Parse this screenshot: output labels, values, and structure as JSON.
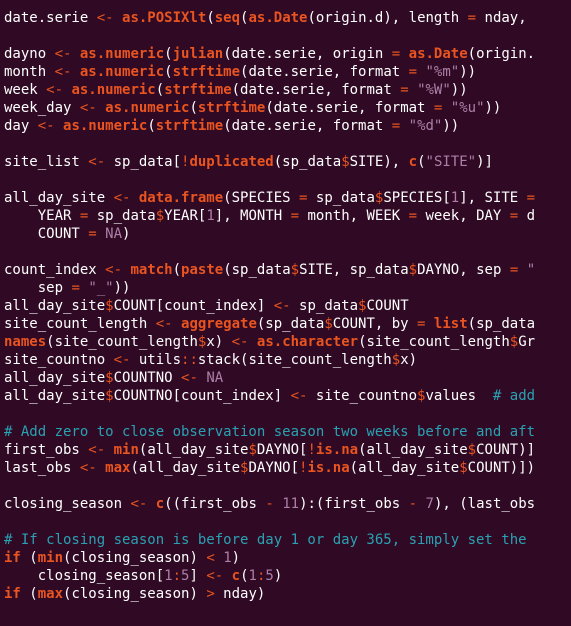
{
  "colors": {
    "background": "#300a24",
    "plain": "#ffffff",
    "operator": "#e95420",
    "function": "#e95420",
    "keyword": "#e95420",
    "string": "#ad7fa8",
    "number": "#ad7fa8",
    "constant": "#ad7fa8",
    "comment": "#2aa1b3"
  },
  "lines": [
    [
      [
        "plain",
        "date.serie "
      ],
      [
        "op",
        "<-"
      ],
      [
        "plain",
        " "
      ],
      [
        "fn",
        "as.POSIXlt"
      ],
      [
        "plain",
        "("
      ],
      [
        "fn",
        "seq"
      ],
      [
        "plain",
        "("
      ],
      [
        "fn",
        "as.Date"
      ],
      [
        "plain",
        "(origin.d), length "
      ],
      [
        "op",
        "="
      ],
      [
        "plain",
        " nday, "
      ]
    ],
    [],
    [
      [
        "plain",
        "dayno "
      ],
      [
        "op",
        "<-"
      ],
      [
        "plain",
        " "
      ],
      [
        "fn",
        "as.numeric"
      ],
      [
        "plain",
        "("
      ],
      [
        "fn",
        "julian"
      ],
      [
        "plain",
        "(date.serie, origin "
      ],
      [
        "op",
        "="
      ],
      [
        "plain",
        " "
      ],
      [
        "fn",
        "as.Date"
      ],
      [
        "plain",
        "(origin."
      ]
    ],
    [
      [
        "plain",
        "month "
      ],
      [
        "op",
        "<-"
      ],
      [
        "plain",
        " "
      ],
      [
        "fn",
        "as.numeric"
      ],
      [
        "plain",
        "("
      ],
      [
        "fn",
        "strftime"
      ],
      [
        "plain",
        "(date.serie, format "
      ],
      [
        "op",
        "="
      ],
      [
        "plain",
        " "
      ],
      [
        "str",
        "\"%m\""
      ],
      [
        "plain",
        "))"
      ]
    ],
    [
      [
        "plain",
        "week "
      ],
      [
        "op",
        "<-"
      ],
      [
        "plain",
        " "
      ],
      [
        "fn",
        "as.numeric"
      ],
      [
        "plain",
        "("
      ],
      [
        "fn",
        "strftime"
      ],
      [
        "plain",
        "(date.serie, format "
      ],
      [
        "op",
        "="
      ],
      [
        "plain",
        " "
      ],
      [
        "str",
        "\"%W\""
      ],
      [
        "plain",
        "))"
      ]
    ],
    [
      [
        "plain",
        "week_day "
      ],
      [
        "op",
        "<-"
      ],
      [
        "plain",
        " "
      ],
      [
        "fn",
        "as.numeric"
      ],
      [
        "plain",
        "("
      ],
      [
        "fn",
        "strftime"
      ],
      [
        "plain",
        "(date.serie, format "
      ],
      [
        "op",
        "="
      ],
      [
        "plain",
        " "
      ],
      [
        "str",
        "\"%u\""
      ],
      [
        "plain",
        "))"
      ]
    ],
    [
      [
        "plain",
        "day "
      ],
      [
        "op",
        "<-"
      ],
      [
        "plain",
        " "
      ],
      [
        "fn",
        "as.numeric"
      ],
      [
        "plain",
        "("
      ],
      [
        "fn",
        "strftime"
      ],
      [
        "plain",
        "(date.serie, format "
      ],
      [
        "op",
        "="
      ],
      [
        "plain",
        " "
      ],
      [
        "str",
        "\"%d\""
      ],
      [
        "plain",
        "))"
      ]
    ],
    [],
    [
      [
        "plain",
        "site_list "
      ],
      [
        "op",
        "<-"
      ],
      [
        "plain",
        " sp_data["
      ],
      [
        "op",
        "!"
      ],
      [
        "fn",
        "duplicated"
      ],
      [
        "plain",
        "(sp_data"
      ],
      [
        "op",
        "$"
      ],
      [
        "plain",
        "SITE), "
      ],
      [
        "fn",
        "c"
      ],
      [
        "plain",
        "("
      ],
      [
        "str",
        "\"SITE\""
      ],
      [
        "plain",
        ")]"
      ]
    ],
    [],
    [
      [
        "plain",
        "all_day_site "
      ],
      [
        "op",
        "<-"
      ],
      [
        "plain",
        " "
      ],
      [
        "fn",
        "data.frame"
      ],
      [
        "plain",
        "(SPECIES "
      ],
      [
        "op",
        "="
      ],
      [
        "plain",
        " sp_data"
      ],
      [
        "op",
        "$"
      ],
      [
        "plain",
        "SPECIES["
      ],
      [
        "num",
        "1"
      ],
      [
        "plain",
        "], SITE "
      ],
      [
        "op",
        "="
      ]
    ],
    [
      [
        "plain",
        "    YEAR "
      ],
      [
        "op",
        "="
      ],
      [
        "plain",
        " sp_data"
      ],
      [
        "op",
        "$"
      ],
      [
        "plain",
        "YEAR["
      ],
      [
        "num",
        "1"
      ],
      [
        "plain",
        "], MONTH "
      ],
      [
        "op",
        "="
      ],
      [
        "plain",
        " month, WEEK "
      ],
      [
        "op",
        "="
      ],
      [
        "plain",
        " week, DAY "
      ],
      [
        "op",
        "="
      ],
      [
        "plain",
        " d"
      ]
    ],
    [
      [
        "plain",
        "    COUNT "
      ],
      [
        "op",
        "="
      ],
      [
        "plain",
        " "
      ],
      [
        "const",
        "NA"
      ],
      [
        "plain",
        ")"
      ]
    ],
    [],
    [
      [
        "plain",
        "count_index "
      ],
      [
        "op",
        "<-"
      ],
      [
        "plain",
        " "
      ],
      [
        "fn",
        "match"
      ],
      [
        "plain",
        "("
      ],
      [
        "fn",
        "paste"
      ],
      [
        "plain",
        "(sp_data"
      ],
      [
        "op",
        "$"
      ],
      [
        "plain",
        "SITE, sp_data"
      ],
      [
        "op",
        "$"
      ],
      [
        "plain",
        "DAYNO, sep "
      ],
      [
        "op",
        "="
      ],
      [
        "plain",
        " "
      ],
      [
        "str",
        "\""
      ]
    ],
    [
      [
        "plain",
        "    sep "
      ],
      [
        "op",
        "="
      ],
      [
        "plain",
        " "
      ],
      [
        "str",
        "\"_\""
      ],
      [
        "plain",
        "))"
      ]
    ],
    [
      [
        "plain",
        "all_day_site"
      ],
      [
        "op",
        "$"
      ],
      [
        "plain",
        "COUNT[count_index] "
      ],
      [
        "op",
        "<-"
      ],
      [
        "plain",
        " sp_data"
      ],
      [
        "op",
        "$"
      ],
      [
        "plain",
        "COUNT"
      ]
    ],
    [
      [
        "plain",
        "site_count_length "
      ],
      [
        "op",
        "<-"
      ],
      [
        "plain",
        " "
      ],
      [
        "fn",
        "aggregate"
      ],
      [
        "plain",
        "(sp_data"
      ],
      [
        "op",
        "$"
      ],
      [
        "plain",
        "COUNT, by "
      ],
      [
        "op",
        "="
      ],
      [
        "plain",
        " "
      ],
      [
        "fn",
        "list"
      ],
      [
        "plain",
        "(sp_data"
      ]
    ],
    [
      [
        "fn",
        "names"
      ],
      [
        "plain",
        "(site_count_length"
      ],
      [
        "op",
        "$"
      ],
      [
        "plain",
        "x) "
      ],
      [
        "op",
        "<-"
      ],
      [
        "plain",
        " "
      ],
      [
        "fn",
        "as.character"
      ],
      [
        "plain",
        "(site_count_length"
      ],
      [
        "op",
        "$"
      ],
      [
        "plain",
        "Gr"
      ]
    ],
    [
      [
        "plain",
        "site_countno "
      ],
      [
        "op",
        "<-"
      ],
      [
        "plain",
        " utils"
      ],
      [
        "op",
        "::"
      ],
      [
        "plain",
        "stack(site_count_length"
      ],
      [
        "op",
        "$"
      ],
      [
        "plain",
        "x)"
      ]
    ],
    [
      [
        "plain",
        "all_day_site"
      ],
      [
        "op",
        "$"
      ],
      [
        "plain",
        "COUNTNO "
      ],
      [
        "op",
        "<-"
      ],
      [
        "plain",
        " "
      ],
      [
        "const",
        "NA"
      ]
    ],
    [
      [
        "plain",
        "all_day_site"
      ],
      [
        "op",
        "$"
      ],
      [
        "plain",
        "COUNTNO[count_index] "
      ],
      [
        "op",
        "<-"
      ],
      [
        "plain",
        " site_countno"
      ],
      [
        "op",
        "$"
      ],
      [
        "plain",
        "values  "
      ],
      [
        "comment",
        "# add"
      ]
    ],
    [],
    [
      [
        "comment",
        "# Add zero to close observation season two weeks before and aft"
      ]
    ],
    [
      [
        "plain",
        "first_obs "
      ],
      [
        "op",
        "<-"
      ],
      [
        "plain",
        " "
      ],
      [
        "fn",
        "min"
      ],
      [
        "plain",
        "(all_day_site"
      ],
      [
        "op",
        "$"
      ],
      [
        "plain",
        "DAYNO["
      ],
      [
        "op",
        "!"
      ],
      [
        "fn",
        "is.na"
      ],
      [
        "plain",
        "(all_day_site"
      ],
      [
        "op",
        "$"
      ],
      [
        "plain",
        "COUNT)]"
      ]
    ],
    [
      [
        "plain",
        "last_obs "
      ],
      [
        "op",
        "<-"
      ],
      [
        "plain",
        " "
      ],
      [
        "fn",
        "max"
      ],
      [
        "plain",
        "(all_day_site"
      ],
      [
        "op",
        "$"
      ],
      [
        "plain",
        "DAYNO["
      ],
      [
        "op",
        "!"
      ],
      [
        "fn",
        "is.na"
      ],
      [
        "plain",
        "(all_day_site"
      ],
      [
        "op",
        "$"
      ],
      [
        "plain",
        "COUNT)])"
      ]
    ],
    [],
    [
      [
        "plain",
        "closing_season "
      ],
      [
        "op",
        "<-"
      ],
      [
        "plain",
        " "
      ],
      [
        "fn",
        "c"
      ],
      [
        "plain",
        "((first_obs "
      ],
      [
        "op",
        "-"
      ],
      [
        "plain",
        " "
      ],
      [
        "num",
        "11"
      ],
      [
        "plain",
        "):(first_obs "
      ],
      [
        "op",
        "-"
      ],
      [
        "plain",
        " "
      ],
      [
        "num",
        "7"
      ],
      [
        "plain",
        "), (last_obs"
      ]
    ],
    [],
    [
      [
        "comment",
        "# If closing season is before day 1 or day 365, simply set the "
      ]
    ],
    [
      [
        "kw",
        "if"
      ],
      [
        "plain",
        " ("
      ],
      [
        "fn",
        "min"
      ],
      [
        "plain",
        "(closing_season) "
      ],
      [
        "op",
        "<"
      ],
      [
        "plain",
        " "
      ],
      [
        "num",
        "1"
      ],
      [
        "plain",
        ")"
      ]
    ],
    [
      [
        "plain",
        "    closing_season["
      ],
      [
        "num",
        "1"
      ],
      [
        "op",
        ":"
      ],
      [
        "num",
        "5"
      ],
      [
        "plain",
        "] "
      ],
      [
        "op",
        "<-"
      ],
      [
        "plain",
        " "
      ],
      [
        "fn",
        "c"
      ],
      [
        "plain",
        "("
      ],
      [
        "num",
        "1"
      ],
      [
        "op",
        ":"
      ],
      [
        "num",
        "5"
      ],
      [
        "plain",
        ")"
      ]
    ],
    [
      [
        "kw",
        "if"
      ],
      [
        "plain",
        " ("
      ],
      [
        "fn",
        "max"
      ],
      [
        "plain",
        "(closing_season) "
      ],
      [
        "op",
        ">"
      ],
      [
        "plain",
        " nday)"
      ]
    ]
  ]
}
